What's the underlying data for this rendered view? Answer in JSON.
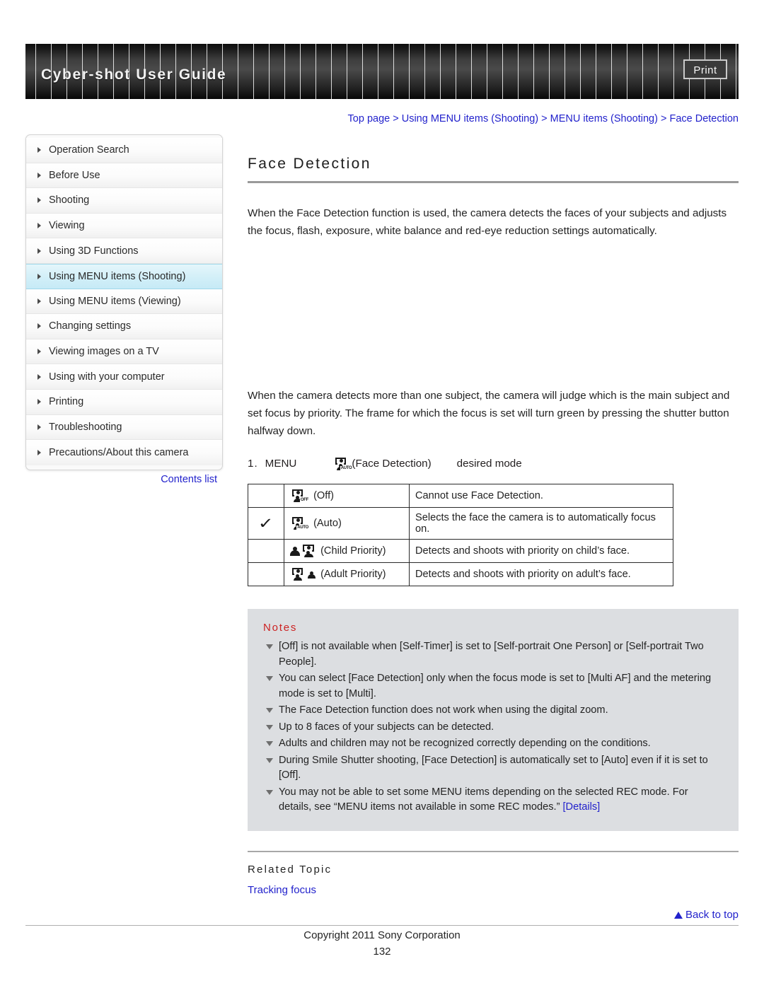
{
  "header": {
    "title": "Cyber-shot User Guide",
    "print_label": "Print"
  },
  "sidebar": {
    "items": [
      {
        "label": "Operation Search",
        "active": false
      },
      {
        "label": "Before Use",
        "active": false
      },
      {
        "label": "Shooting",
        "active": false
      },
      {
        "label": "Viewing",
        "active": false
      },
      {
        "label": "Using 3D Functions",
        "active": false
      },
      {
        "label": "Using MENU items (Shooting)",
        "active": true
      },
      {
        "label": "Using MENU items (Viewing)",
        "active": false
      },
      {
        "label": "Changing settings",
        "active": false
      },
      {
        "label": "Viewing images on a TV",
        "active": false
      },
      {
        "label": "Using with your computer",
        "active": false
      },
      {
        "label": "Printing",
        "active": false
      },
      {
        "label": "Troubleshooting",
        "active": false
      },
      {
        "label": "Precautions/About this camera",
        "active": false
      }
    ],
    "contents_list_label": "Contents list"
  },
  "main": {
    "breadcrumb": "Top page > Using MENU items (Shooting) > MENU items (Shooting) > Face Detection",
    "title": "Face Detection",
    "paragraph_1": "When the Face Detection function is used, the camera detects the faces of your subjects and adjusts the focus, flash, exposure, white balance and red-eye reduction settings automatically.",
    "paragraph_2": "When the camera detects more than one subject, the camera will judge which is the main subject and set focus by priority. The frame for which the focus is set will turn green by pressing the shutter button halfway down.",
    "step": {
      "number": "1.",
      "menu_label": "MENU",
      "icon_name": "face-detection-auto-icon",
      "icon_tag": "AUTO",
      "icon_caption": "(Face Detection)",
      "trailing_label": "desired mode"
    },
    "table": {
      "rows": [
        {
          "checked": false,
          "check_glyph": "",
          "icon_name": "face-detection-off-icon",
          "icon_tag": "OFF",
          "mode": "(Off)",
          "description": "Cannot use Face Detection."
        },
        {
          "checked": true,
          "check_glyph": "✓",
          "icon_name": "face-detection-auto-icon",
          "icon_tag": "AUTO",
          "mode": "(Auto)",
          "description": "Selects the face the camera is to automatically focus on."
        },
        {
          "checked": false,
          "check_glyph": "",
          "icon_name": "face-detection-child-priority-icon",
          "icon_tag": "",
          "mode": "(Child Priority)",
          "description": "Detects and shoots with priority on child’s face."
        },
        {
          "checked": false,
          "check_glyph": "",
          "icon_name": "face-detection-adult-priority-icon",
          "icon_tag": "",
          "mode": "(Adult Priority)",
          "description": "Detects and shoots with priority on adult’s face."
        }
      ]
    },
    "notes": {
      "title": "Notes",
      "items": [
        "[Off] is not available when [Self-Timer] is set to [Self-portrait One Person] or [Self-portrait Two People].",
        "You can select [Face Detection] only when the focus mode is set to [Multi AF] and the metering mode is set to [Multi].",
        "The Face Detection function does not work when using the digital zoom.",
        "Up to 8 faces of your subjects can be detected.",
        "Adults and children may not be recognized correctly depending on the conditions.",
        "During Smile Shutter shooting, [Face Detection] is automatically set to [Auto] even if it is set to [Off]."
      ],
      "last_item_text": "You may not be able to set some MENU items depending on the selected REC mode. For details, see “MENU items not available in some REC modes.” ",
      "last_item_link": "[Details]"
    },
    "related": {
      "title": "Related Topic",
      "link": "Tracking focus"
    },
    "back_to_top": "Back to top"
  },
  "footer": {
    "copyright": "Copyright 2011 Sony Corporation",
    "page_number": "132"
  },
  "colors": {
    "link": "#2222cc",
    "notes_title": "#cc2222",
    "notes_bg": "#dcdee1",
    "sidebar_active": "#d2eff8"
  }
}
